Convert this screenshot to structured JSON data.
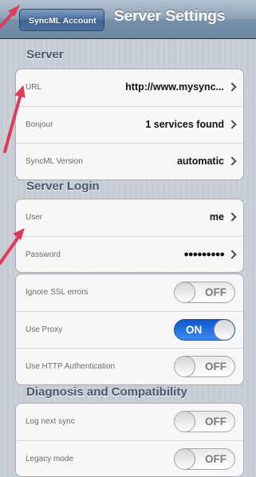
{
  "navbar": {
    "back_label": "SyncML Account",
    "title": "Server Settings"
  },
  "sections": {
    "server": {
      "title": "Server",
      "rows": [
        {
          "label": "URL",
          "value": "http://www.mysync..."
        },
        {
          "label": "Bonjour",
          "value": "1 services found"
        },
        {
          "label": "SyncML Version",
          "value": "automatic"
        }
      ]
    },
    "login": {
      "title": "Server Login",
      "rows": [
        {
          "label": "User",
          "value": "me"
        },
        {
          "label": "Password",
          "value": "●●●●●●●●●"
        }
      ]
    },
    "options": {
      "rows": [
        {
          "label": "Ignore SSL errors",
          "state": "OFF"
        },
        {
          "label": "Use Proxy",
          "state": "ON"
        },
        {
          "label": "Use HTTP Authentication",
          "state": "OFF"
        }
      ]
    },
    "diagnosis": {
      "title": "Diagnosis and Compatibility",
      "rows": [
        {
          "label": "Log next sync",
          "state": "OFF"
        },
        {
          "label": "Legacy mode",
          "state": "OFF"
        }
      ]
    }
  },
  "colors": {
    "annotation_arrow": "#e0395a",
    "toggle_on": "#1f6fe0"
  }
}
